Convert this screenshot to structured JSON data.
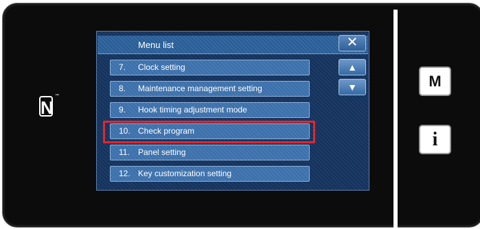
{
  "device": {
    "nfc_symbol": "N",
    "nfc_tm": "™",
    "m_button_label": "M",
    "i_button_label": "i"
  },
  "dialog": {
    "title": "Menu list",
    "close_symbol": "✕",
    "scroll_up_symbol": "▲",
    "scroll_down_symbol": "▼"
  },
  "menu": {
    "items": [
      {
        "num": "7.",
        "label": "Clock setting"
      },
      {
        "num": "8.",
        "label": "Maintenance management setting"
      },
      {
        "num": "9.",
        "label": "Hook timing adjustment mode"
      },
      {
        "num": "10.",
        "label": "Check program",
        "highlighted": true
      },
      {
        "num": "11.",
        "label": "Panel setting"
      },
      {
        "num": "12.",
        "label": "Key customization setting"
      }
    ]
  },
  "colors": {
    "highlight": "#e5262b",
    "panel": "#1c3c68",
    "button": "#4679b3"
  }
}
